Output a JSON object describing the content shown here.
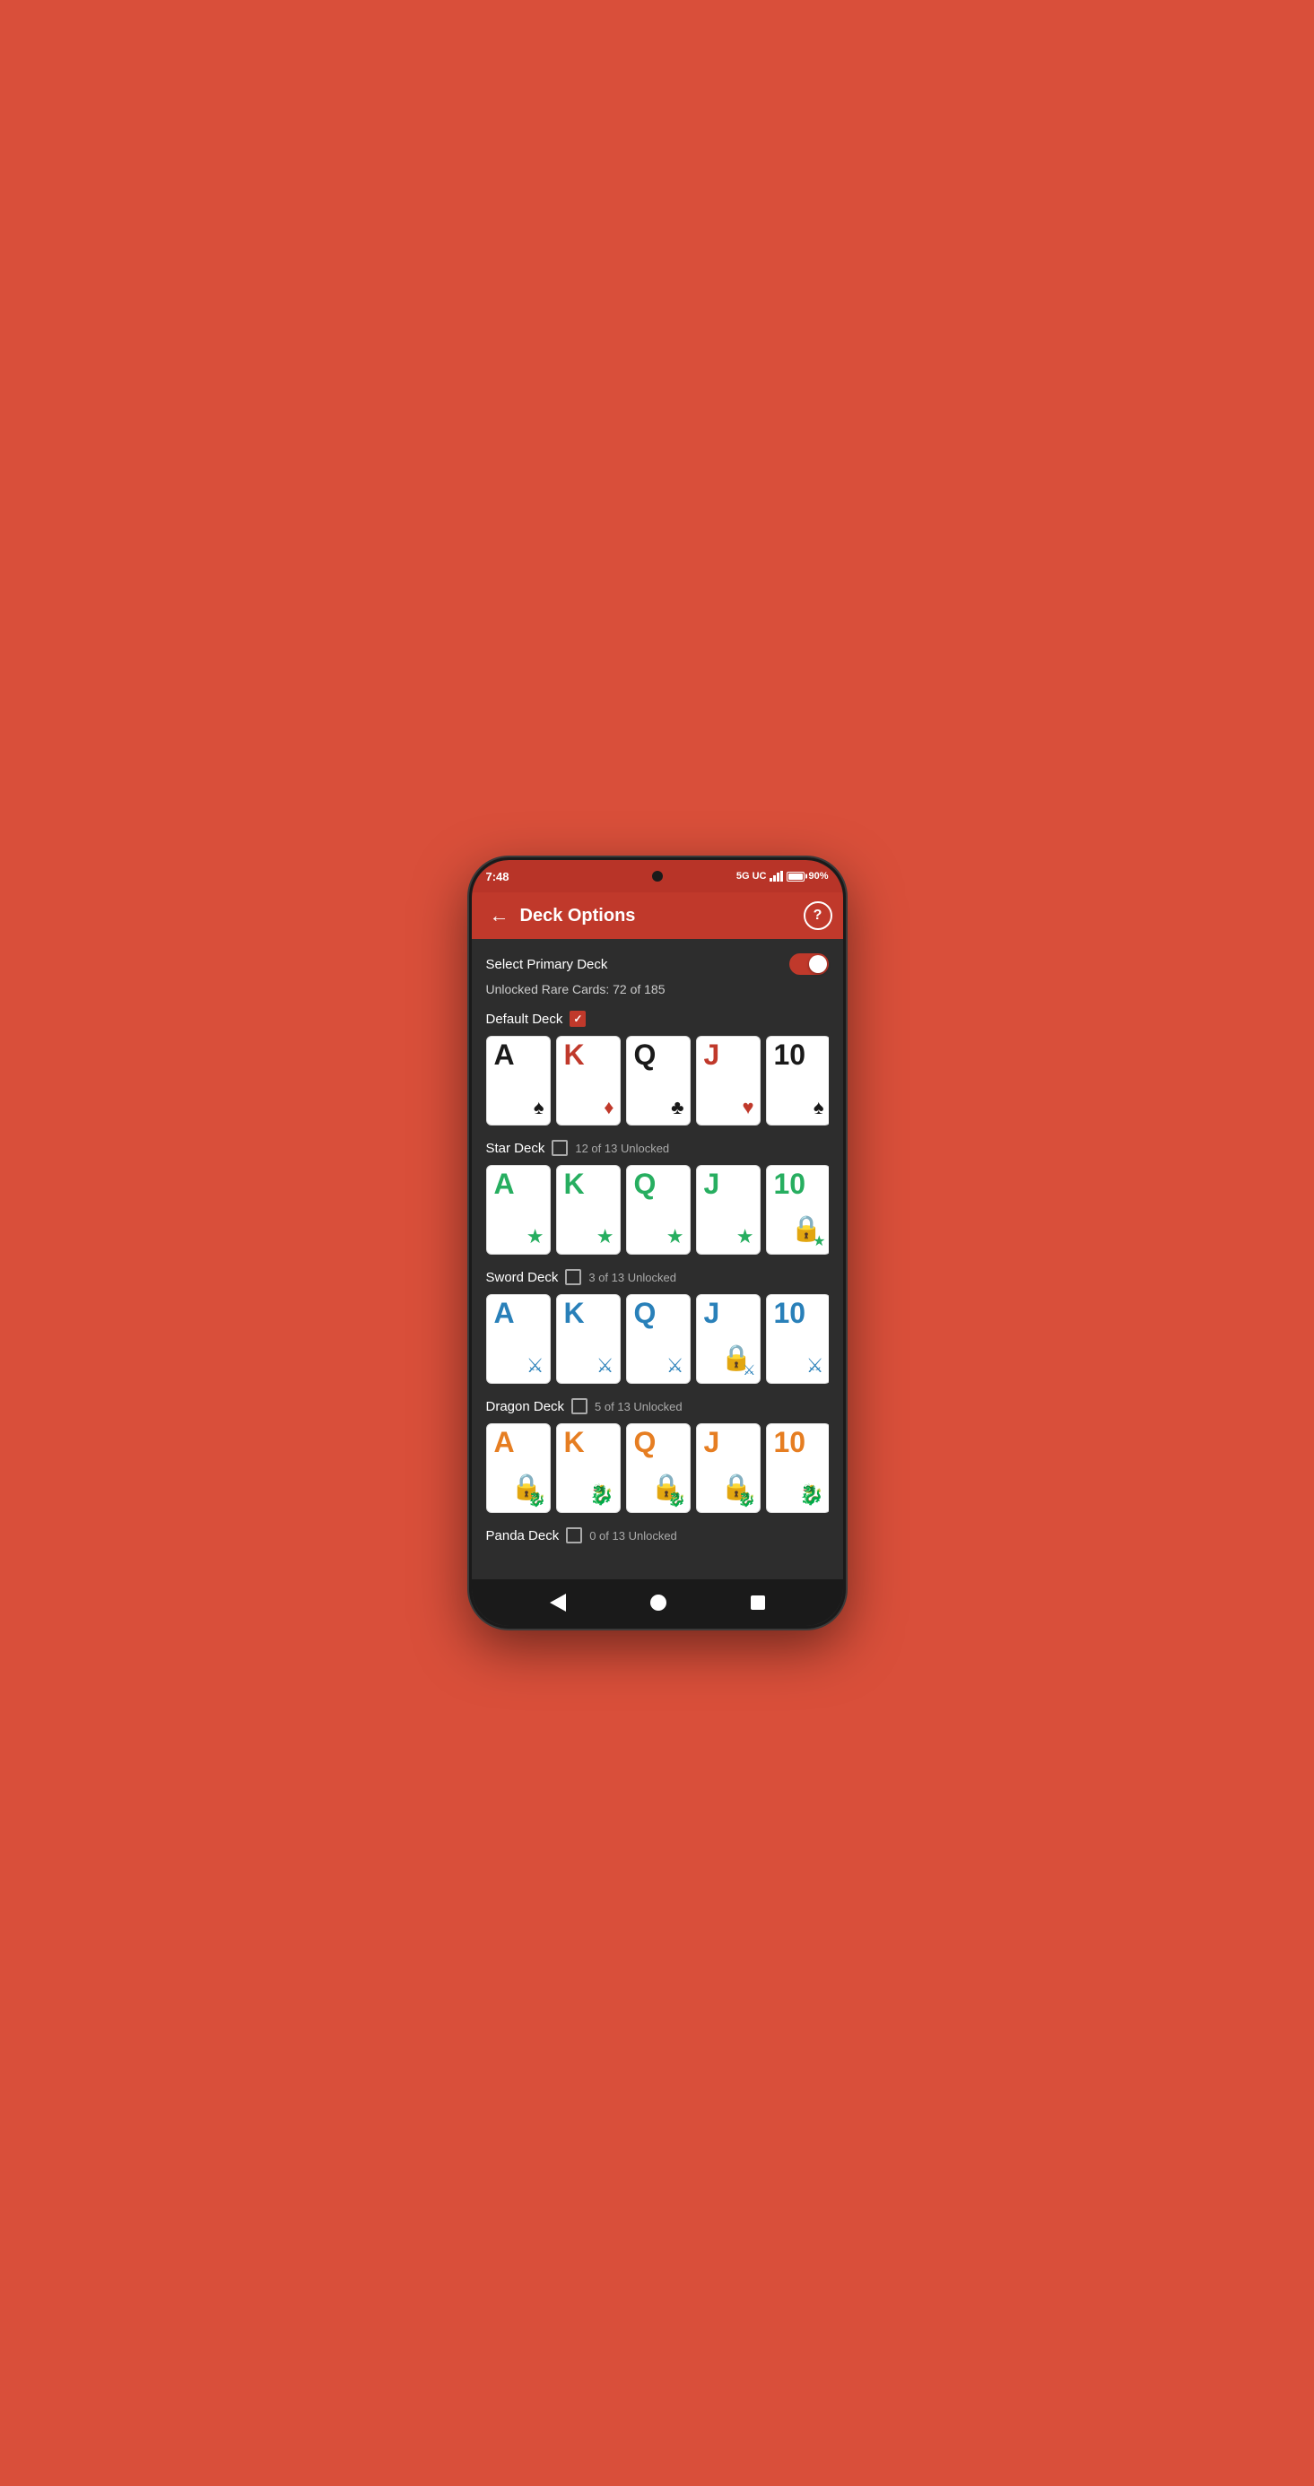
{
  "statusBar": {
    "time": "7:48",
    "network": "5G UC",
    "battery": "90%",
    "batteryWidth": "85%"
  },
  "appBar": {
    "title": "Deck Options",
    "backLabel": "←",
    "helpLabel": "?"
  },
  "primaryDeck": {
    "label": "Select Primary Deck",
    "toggleOn": true
  },
  "unlockedRare": {
    "text": "Unlocked Rare Cards: 72 of 185"
  },
  "decks": [
    {
      "name": "Default Deck",
      "checked": true,
      "unlockText": "",
      "cards": [
        {
          "letter": "A",
          "suit": "♠",
          "color": "black",
          "locked": false,
          "suitColor": "black"
        },
        {
          "letter": "K",
          "suit": "♦",
          "color": "red",
          "locked": false,
          "suitColor": "red"
        },
        {
          "letter": "Q",
          "suit": "♣",
          "color": "black",
          "locked": false,
          "suitColor": "black"
        },
        {
          "letter": "J",
          "suit": "♥",
          "color": "red",
          "locked": false,
          "suitColor": "red"
        },
        {
          "letter": "10",
          "suit": "♠",
          "color": "black",
          "locked": false,
          "suitColor": "black"
        }
      ]
    },
    {
      "name": "Star Deck",
      "checked": false,
      "unlockText": "12 of 13 Unlocked",
      "cards": [
        {
          "letter": "A",
          "suit": "★",
          "color": "green",
          "locked": false,
          "suitColor": "green"
        },
        {
          "letter": "K",
          "suit": "★",
          "color": "green",
          "locked": false,
          "suitColor": "green"
        },
        {
          "letter": "Q",
          "suit": "★",
          "color": "green",
          "locked": false,
          "suitColor": "green"
        },
        {
          "letter": "J",
          "suit": "★",
          "color": "green",
          "locked": false,
          "suitColor": "green"
        },
        {
          "letter": "10",
          "suit": "★",
          "color": "green",
          "locked": true,
          "suitColor": "green"
        }
      ]
    },
    {
      "name": "Sword Deck",
      "checked": false,
      "unlockText": "3 of 13 Unlocked",
      "cards": [
        {
          "letter": "A",
          "suit": "🗡",
          "color": "blue",
          "locked": false,
          "suitColor": "blue"
        },
        {
          "letter": "K",
          "suit": "🗡",
          "color": "blue",
          "locked": false,
          "suitColor": "blue"
        },
        {
          "letter": "Q",
          "suit": "🗡",
          "color": "blue",
          "locked": false,
          "suitColor": "blue"
        },
        {
          "letter": "J",
          "suit": "🗡",
          "color": "blue",
          "locked": true,
          "suitColor": "blue"
        },
        {
          "letter": "10",
          "suit": "🗡",
          "color": "blue",
          "locked": false,
          "suitColor": "blue"
        }
      ]
    },
    {
      "name": "Dragon Deck",
      "checked": false,
      "unlockText": "5 of 13 Unlocked",
      "cards": [
        {
          "letter": "A",
          "suit": "🐉",
          "color": "orange",
          "locked": true,
          "suitColor": "orange"
        },
        {
          "letter": "K",
          "suit": "🐉",
          "color": "orange",
          "locked": false,
          "suitColor": "orange"
        },
        {
          "letter": "Q",
          "suit": "🐉",
          "color": "orange",
          "locked": true,
          "suitColor": "orange"
        },
        {
          "letter": "J",
          "suit": "🐉",
          "color": "orange",
          "locked": true,
          "suitColor": "orange"
        },
        {
          "letter": "10",
          "suit": "🐉",
          "color": "orange",
          "locked": false,
          "suitColor": "orange"
        }
      ]
    },
    {
      "name": "Panda Deck",
      "checked": false,
      "unlockText": "0 of 13 Unlocked",
      "cards": []
    }
  ],
  "bottomNav": {
    "back": "◀",
    "home": "●",
    "recent": "■"
  }
}
